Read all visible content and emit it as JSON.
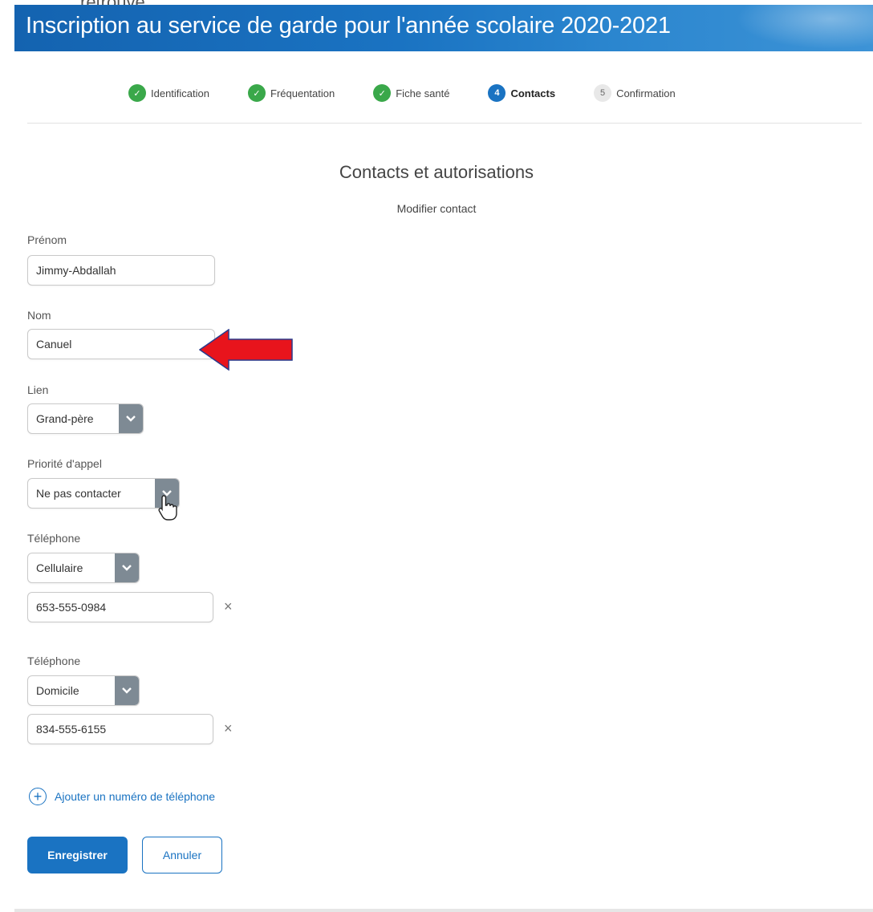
{
  "window": {
    "top_fragment": "retrouve.",
    "title": "Inscription au service de garde pour l'année scolaire 2020-2021"
  },
  "stepper": {
    "steps": [
      {
        "label": "Identification",
        "status": "done",
        "badge": "✓"
      },
      {
        "label": "Fréquentation",
        "status": "done",
        "badge": "✓"
      },
      {
        "label": "Fiche santé",
        "status": "done",
        "badge": "✓"
      },
      {
        "label": "Contacts",
        "status": "active",
        "badge": "4"
      },
      {
        "label": "Confirmation",
        "status": "todo",
        "badge": "5"
      }
    ]
  },
  "section": {
    "title": "Contacts et autorisations",
    "subtitle": "Modifier contact"
  },
  "form": {
    "first_name": {
      "label": "Prénom",
      "value": "Jimmy-Abdallah"
    },
    "last_name": {
      "label": "Nom",
      "value": "Canuel"
    },
    "relation": {
      "label": "Lien",
      "value": "Grand-père"
    },
    "call_priority": {
      "label": "Priorité d'appel",
      "value": "Ne pas contacter"
    },
    "phones": [
      {
        "label": "Téléphone",
        "type": "Cellulaire",
        "number": "653-555-0984",
        "clear": "×"
      },
      {
        "label": "Téléphone",
        "type": "Domicile",
        "number": "834-555-6155",
        "clear": "×"
      }
    ],
    "add_phone": {
      "icon": "plus-circle-icon",
      "label": "Ajouter un numéro de téléphone"
    }
  },
  "actions": {
    "save_label": "Enregistrer",
    "cancel_label": "Annuler"
  },
  "colors": {
    "accent": "#1a73c2",
    "done": "#3aa84a",
    "chevron_bg": "#7e8a94",
    "annotation_arrow": "#e8141c"
  }
}
